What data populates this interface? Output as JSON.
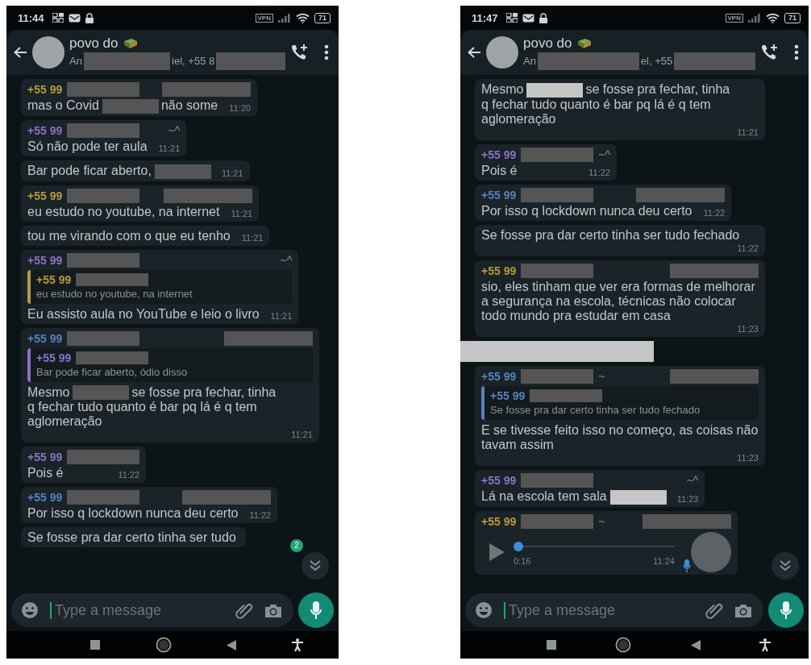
{
  "phones": [
    {
      "status": {
        "time": "11:44",
        "vpn": "VPN",
        "battery": "71"
      },
      "header": {
        "title": "povo do",
        "subtitle": [
          {
            "kind": "text",
            "text": "An"
          },
          {
            "kind": "redaction"
          },
          {
            "kind": "text",
            "text": "iel, +55 8"
          },
          {
            "kind": "redaction"
          }
        ]
      },
      "messages": [
        {
          "kind": "text",
          "sender": {
            "number": "+55 99",
            "color": "#b89a3e",
            "parts": [
              {
                "kind": "redaction"
              },
              {
                "kind": "redaction"
              }
            ]
          },
          "body": [
            {
              "kind": "text",
              "text": "mas o Covid"
            },
            {
              "kind": "redaction"
            },
            {
              "kind": "text",
              "text": "não some"
            }
          ],
          "time": "11:20"
        },
        {
          "kind": "text",
          "sender": {
            "number": "+55 99",
            "color": "#8c73c4",
            "parts": [
              {
                "kind": "redaction"
              },
              {
                "kind": "text",
                "text": "~^"
              }
            ]
          },
          "body": [
            {
              "kind": "text",
              "text": "Só não pode ter aula"
            }
          ],
          "time": "11:21"
        },
        {
          "kind": "text",
          "body": [
            {
              "kind": "text",
              "text": "Bar pode ficar aberto,"
            },
            {
              "kind": "redaction"
            }
          ],
          "time": "11:21"
        },
        {
          "kind": "text",
          "sender": {
            "number": "+55 99",
            "color": "#b89a3e",
            "parts": [
              {
                "kind": "redaction"
              },
              {
                "kind": "redaction"
              }
            ]
          },
          "body": [
            {
              "kind": "text",
              "text": "eu estudo no youtube, na internet"
            }
          ],
          "time": "11:21"
        },
        {
          "kind": "text",
          "body": [
            {
              "kind": "text",
              "text": "tou me virando com o que eu tenho"
            }
          ],
          "time": "11:21"
        },
        {
          "kind": "text",
          "sender": {
            "number": "+55 99",
            "color": "#8c73c4",
            "parts": [
              {
                "kind": "redaction"
              },
              {
                "kind": "text",
                "text": "~^"
              }
            ]
          },
          "quote": {
            "number": "+55 99",
            "color": "#b89a3e",
            "parts": [
              {
                "kind": "redaction"
              }
            ],
            "text": "eu estudo no youtube, na internet"
          },
          "body": [
            {
              "kind": "text",
              "text": "Eu assisto aula no YouTube e leio o livro"
            }
          ],
          "time": "11:21"
        },
        {
          "kind": "text",
          "sender": {
            "number": "+55 99",
            "color": "#5483c0",
            "parts": [
              {
                "kind": "redaction"
              },
              {
                "kind": "redaction"
              }
            ]
          },
          "quote": {
            "number": "+55 99",
            "color": "#8c73c4",
            "parts": [
              {
                "kind": "redaction"
              }
            ],
            "text": "Bar pode ficar aberto, ódio disso"
          },
          "body": [
            {
              "kind": "text",
              "text": "Mesmo"
            },
            {
              "kind": "redaction"
            },
            {
              "kind": "text",
              "text": "se fosse pra fechar, tinha"
            },
            {
              "kind": "text",
              "text": "q fechar tudo quanto é bar pq lá é q tem"
            },
            {
              "kind": "text",
              "text": "aglomeração"
            }
          ],
          "time": "11:21"
        },
        {
          "kind": "text",
          "sender": {
            "number": "+55 99",
            "color": "#8c73c4",
            "parts": [
              {
                "kind": "redaction"
              }
            ]
          },
          "body": [
            {
              "kind": "text",
              "text": "Pois é"
            }
          ],
          "time": "11:22"
        },
        {
          "kind": "text",
          "sender": {
            "number": "+55 99",
            "color": "#5483c0",
            "parts": [
              {
                "kind": "redaction"
              },
              {
                "kind": "redaction"
              }
            ]
          },
          "body": [
            {
              "kind": "text",
              "text": "Por isso q lockdown nunca deu certo"
            }
          ],
          "time": "11:22"
        },
        {
          "kind": "text",
          "body": [
            {
              "kind": "text",
              "text": "Se fosse pra dar certo tinha ser tudo"
            }
          ]
        }
      ],
      "unread": "2",
      "composer": {
        "placeholder": "Type a message"
      }
    },
    {
      "status": {
        "time": "11:47",
        "vpn": "VPN",
        "battery": "71"
      },
      "header": {
        "title": "povo do",
        "subtitle": [
          {
            "kind": "text",
            "text": "An"
          },
          {
            "kind": "redaction"
          },
          {
            "kind": "text",
            "text": "el, +55"
          },
          {
            "kind": "redaction"
          }
        ]
      },
      "messages": [
        {
          "kind": "text",
          "body": [
            {
              "kind": "text",
              "text": "Mesmo"
            },
            {
              "kind": "redaction",
              "color": "#c6c6c6"
            },
            {
              "kind": "text",
              "text": "se fosse pra fechar, tinha"
            },
            {
              "kind": "text",
              "text": "q fechar tudo quanto é bar pq lá é q tem"
            },
            {
              "kind": "text",
              "text": "aglomeração"
            }
          ],
          "time": "11:21"
        },
        {
          "kind": "text",
          "sender": {
            "number": "+55 99",
            "color": "#8c73c4",
            "parts": [
              {
                "kind": "redaction"
              },
              {
                "kind": "text",
                "text": "~^"
              }
            ]
          },
          "body": [
            {
              "kind": "text",
              "text": "Pois é"
            }
          ],
          "time": "11:22"
        },
        {
          "kind": "text",
          "sender": {
            "number": "+55 99",
            "color": "#5483c0",
            "parts": [
              {
                "kind": "redaction"
              },
              {
                "kind": "redaction"
              }
            ]
          },
          "body": [
            {
              "kind": "text",
              "text": "Por isso q lockdown nunca deu certo"
            }
          ],
          "time": "11:22"
        },
        {
          "kind": "text",
          "body": [
            {
              "kind": "text",
              "text": "Se fosse pra dar certo tinha ser tudo fechado"
            }
          ],
          "time": "11:22"
        },
        {
          "kind": "text",
          "sender": {
            "number": "+55 99",
            "color": "#b89a3e",
            "parts": [
              {
                "kind": "redaction"
              },
              {
                "kind": "redaction"
              }
            ]
          },
          "body": [
            {
              "kind": "text",
              "text": "sio, eles tinham que ver era formas de melhorar a segurança na escola, técnicas não colocar todo mundo pra estudar em casa"
            }
          ],
          "time": "11:23"
        },
        {
          "kind": "redaction",
          "color": "#c6c6c6"
        },
        {
          "kind": "text",
          "sender": {
            "number": "+55 99",
            "color": "#5483c0",
            "parts": [
              {
                "kind": "redaction"
              },
              {
                "kind": "text",
                "text": "~"
              },
              {
                "kind": "redaction"
              }
            ]
          },
          "quote": {
            "number": "+55 99",
            "color": "#5483c0",
            "parts": [
              {
                "kind": "redaction"
              }
            ],
            "text": "Se fosse pra dar certo tinha ser tudo fechado"
          },
          "body": [
            {
              "kind": "text",
              "text": "E se tivesse feito isso no começo, as coisas não tavam assim"
            }
          ],
          "time": "11:23"
        },
        {
          "kind": "text",
          "sender": {
            "number": "+55 99",
            "color": "#8c73c4",
            "parts": [
              {
                "kind": "redaction"
              },
              {
                "kind": "text",
                "text": "~^"
              }
            ]
          },
          "body": [
            {
              "kind": "text",
              "text": "Lá na escola tem sala"
            },
            {
              "kind": "redaction",
              "color": "#c6c6c6"
            }
          ],
          "time": "11:23"
        },
        {
          "kind": "audio",
          "sender": {
            "number": "+55 99",
            "color": "#b89a3e",
            "parts": [
              {
                "kind": "redaction"
              },
              {
                "kind": "text",
                "text": "~"
              },
              {
                "kind": "redaction"
              }
            ]
          },
          "level": 0,
          "duration": "0:16",
          "time": "11:24"
        }
      ],
      "composer": {
        "placeholder": "Type a message"
      }
    }
  ]
}
